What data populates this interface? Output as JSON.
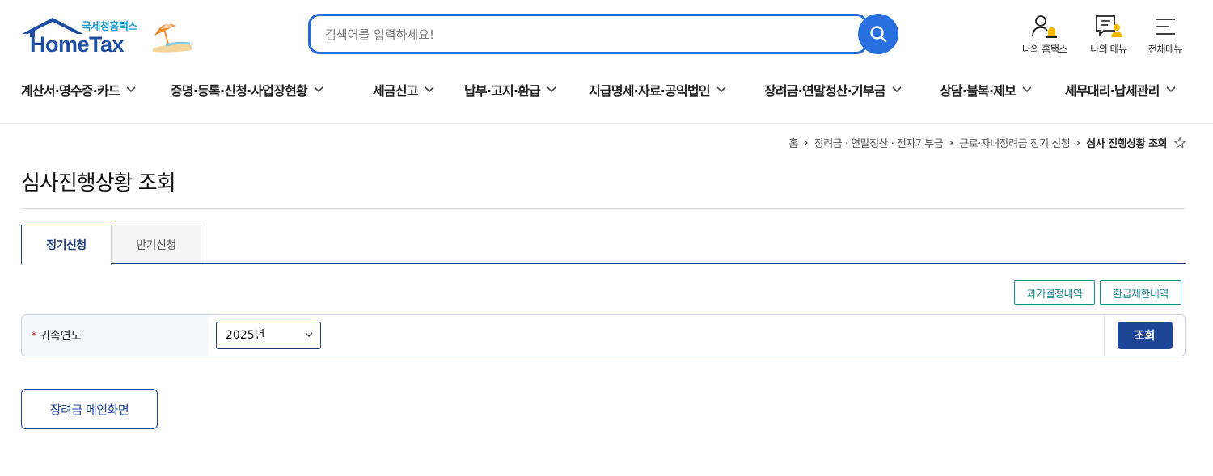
{
  "header": {
    "logo_tagline": "국세청홈택스",
    "logo_word": "HomeTax",
    "search_placeholder": "검색어를 입력하세요!",
    "utils": [
      {
        "label": "나의 홈택스",
        "icon": "user-bell-icon"
      },
      {
        "label": "나의 메뉴",
        "icon": "menu-user-icon"
      },
      {
        "label": "전체메뉴",
        "icon": "hamburger-icon"
      }
    ]
  },
  "gnb": [
    {
      "label": "계산서·영수증·카드"
    },
    {
      "label": "증명·등록·신청·사업장현황"
    },
    {
      "label": "세금신고"
    },
    {
      "label": "납부·고지·환급"
    },
    {
      "label": "지급명세·자료·공익법인"
    },
    {
      "label": "장려금·연말정산·기부금"
    },
    {
      "label": "상담·불복·제보"
    },
    {
      "label": "세무대리·납세관리"
    }
  ],
  "breadcrumb": {
    "items": [
      "홈",
      "장려금 · 연말정산 · 전자기부금",
      "근로·자녀장려금 정기 신청"
    ],
    "current": "심사 진행상황 조회"
  },
  "page": {
    "title": "심사진행상황 조회",
    "tabs": [
      {
        "label": "정기신청",
        "active": true
      },
      {
        "label": "반기신청",
        "active": false
      }
    ],
    "sub_buttons": {
      "past": "과거결정내역",
      "limit": "환급제한내역"
    },
    "condition": {
      "label": "귀속연도",
      "required_mark": "*",
      "year_value": "2025년",
      "search_button": "조회"
    },
    "main_button": "장려금 메인화면"
  },
  "colors": {
    "primary": "#1f4596",
    "search_border": "#2569d3",
    "teal": "#178a8a",
    "required": "#d52b2b"
  }
}
